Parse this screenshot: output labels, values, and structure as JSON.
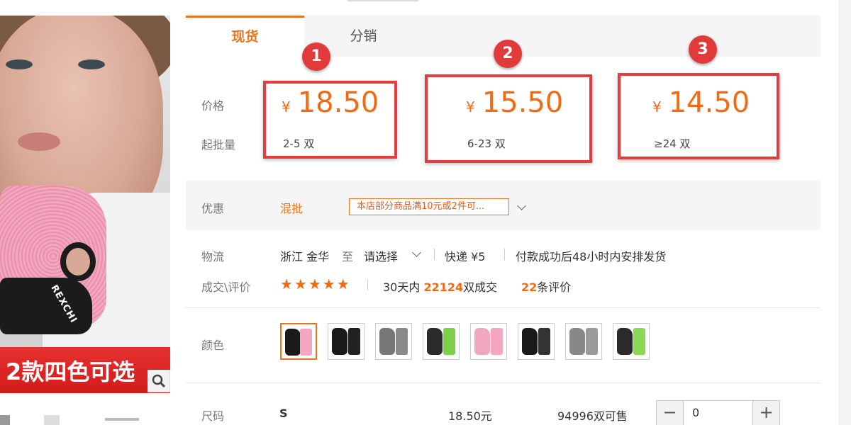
{
  "product_image": {
    "banner_text": "2款四色可选",
    "brand_text": "REXCHI",
    "zoom_icon": "magnifier-icon"
  },
  "tabs": [
    {
      "label": "现货",
      "active": true
    },
    {
      "label": "分销",
      "active": false
    }
  ],
  "price": {
    "price_label": "价格",
    "moq_label": "起批量",
    "currency_symbol": "¥",
    "tiers": [
      {
        "badge": "1",
        "price": "18.50",
        "range": "2-5 双"
      },
      {
        "badge": "2",
        "price": "15.50",
        "range": "6-23 双"
      },
      {
        "badge": "3",
        "price": "14.50",
        "range": "≥24 双"
      }
    ]
  },
  "promo": {
    "label": "优惠",
    "type": "混批",
    "tag": "本店部分商品满10元或2件可...",
    "chevron_icon": "chevron-down-icon"
  },
  "logistics": {
    "label": "物流",
    "origin": "浙江 金华",
    "to": "至",
    "destination": "请选择",
    "express": "快递 ¥5",
    "dispatch": "付款成功后48小时内安排发货"
  },
  "trade": {
    "label": "成交\\评价",
    "stars": "★★★★★",
    "sales_prefix": "30天内",
    "sales_count": "22124",
    "sales_suffix": "双成交",
    "review_count": "22",
    "review_suffix": "条评价"
  },
  "colors": {
    "label": "颜色",
    "swatches": [
      {
        "glove": "#1a1a1a",
        "pack": "#f4a6c2",
        "selected": true
      },
      {
        "glove": "#1a1a1a",
        "pack": "#222222",
        "selected": false
      },
      {
        "glove": "#777777",
        "pack": "#8a8a8a",
        "selected": false
      },
      {
        "glove": "#2a2a2a",
        "pack": "#7cd04a",
        "selected": false
      },
      {
        "glove": "#f2a7bf",
        "pack": "#f4a6c2",
        "selected": false
      },
      {
        "glove": "#1a1a1a",
        "pack": "#333333",
        "selected": false
      },
      {
        "glove": "#888888",
        "pack": "#9a9a9a",
        "selected": false
      },
      {
        "glove": "#2a2a2a",
        "pack": "#8bd854",
        "selected": false
      }
    ]
  },
  "size": {
    "label": "尺码",
    "value": "S",
    "price": "18.50元",
    "stock": "94996双可售",
    "quantity": "0",
    "minus": "−",
    "plus": "+"
  },
  "colors_accent": {
    "orange": "#e8741d",
    "red_box": "#e43d3d"
  }
}
